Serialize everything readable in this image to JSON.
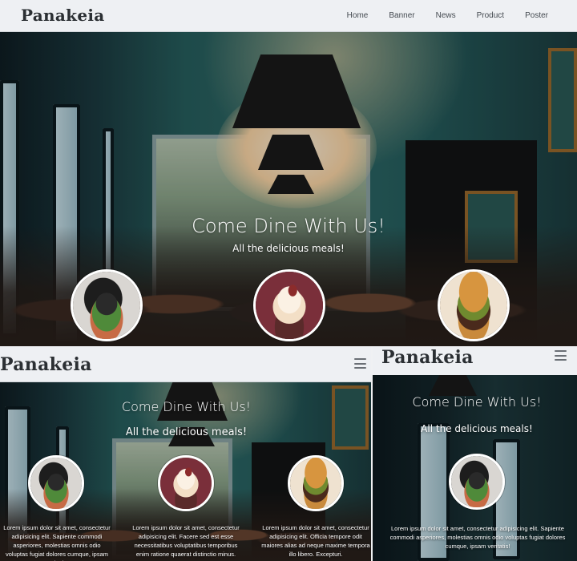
{
  "brand": "Panakeia",
  "nav": {
    "links": [
      "Home",
      "Banner",
      "News",
      "Product",
      "Poster"
    ]
  },
  "hero": {
    "title": "Come Dine With Us!",
    "subtitle": "All the delicious meals!"
  },
  "cards": [
    {
      "image": "black-bun-burger",
      "text": "Lorem ipsum dolor sit amet, consectetur adipisicing elit. Sapiente commodi asperiores, molestias omnis odio voluptas fugiat dolores cumque, ipsam veritatis!"
    },
    {
      "image": "cupcake",
      "text": "Lorem ipsum dolor sit amet, consectetur adipisicing elit. Facere sed est esse necessitatibus voluptatibus temporibus enim ratione quaerat distinctio minus."
    },
    {
      "image": "burger",
      "text": "Lorem ipsum dolor sit amet, consectetur adipisicing elit. Officia tempore odit maiores alias ad neque maxime tempora illo libero. Excepturi."
    }
  ],
  "mobile_card_text": "Lorem ipsum dolor sit amet, consectetur adipisicing elit. Sapiente commodi asperiores, molestias omnis odio voluptas fugiat dolores cumque, ipsam veritatis!",
  "icons": {
    "menu": "hamburger-menu-icon"
  },
  "colors": {
    "navbar_bg": "#eef0f3",
    "brand_text": "#2b2f33",
    "hero_text": "#ffffff",
    "accent_teal": "#2f6c6a"
  }
}
